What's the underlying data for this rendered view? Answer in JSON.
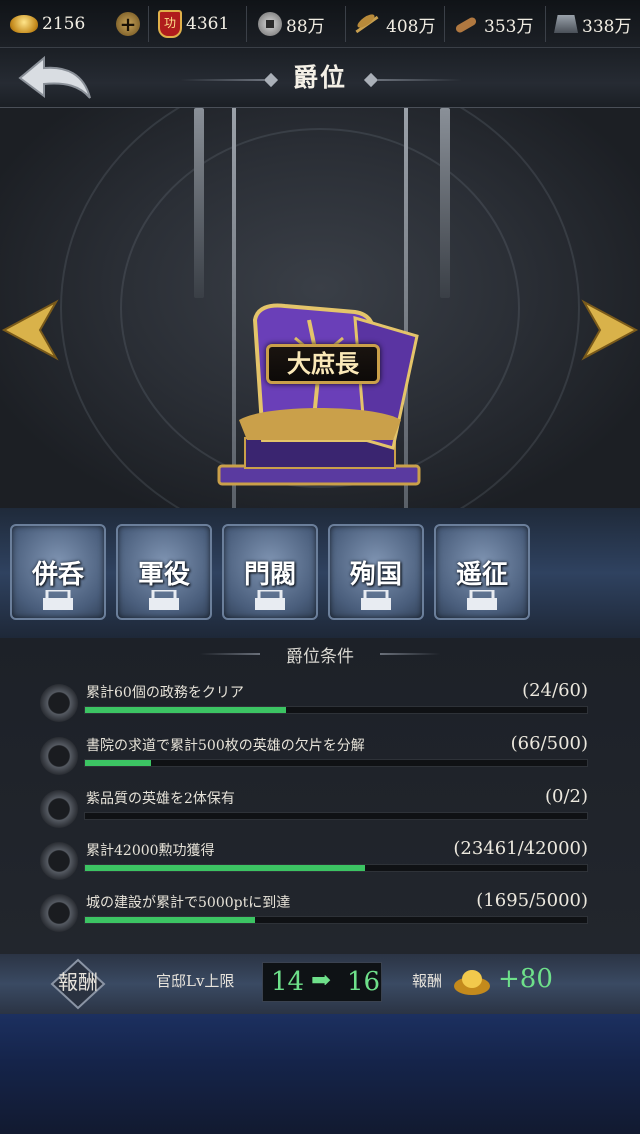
{
  "resources": {
    "gold": "2156",
    "merit": "4361",
    "merit_icon_char": "功",
    "coins": "88万",
    "grain": "408万",
    "wood": "353万",
    "iron": "338万"
  },
  "header": {
    "title": "爵位"
  },
  "showcase": {
    "rank_name": "大庶長"
  },
  "categories": [
    {
      "label": "併呑"
    },
    {
      "label": "軍役"
    },
    {
      "label": "門閥"
    },
    {
      "label": "殉国"
    },
    {
      "label": "遥征"
    }
  ],
  "conditions": {
    "title": "爵位条件",
    "items": [
      {
        "text": "累計60個の政務をクリア",
        "count": "(24/60)",
        "current": 24,
        "target": 60
      },
      {
        "text": "書院の求道で累計500枚の英雄の欠片を分解",
        "count": "(66/500)",
        "current": 66,
        "target": 500
      },
      {
        "text": "紫品質の英雄を2体保有",
        "count": "(0/2)",
        "current": 0,
        "target": 2
      },
      {
        "text": "累計42000勲功獲得",
        "count": "(23461/42000)",
        "current": 23461,
        "target": 42000
      },
      {
        "text": "城の建設が累計で5000ptに到達",
        "count": "(1695/5000)",
        "current": 1695,
        "target": 5000
      }
    ]
  },
  "reward": {
    "badge": "報酬",
    "desc": "官邸Lv上限",
    "from": "14",
    "arrow": "➡",
    "to": "16",
    "label": "報酬",
    "amount": "+80"
  },
  "colors": {
    "progress": "#3cc463",
    "accent": "#caa04a",
    "highlight": "#6ee08a"
  }
}
